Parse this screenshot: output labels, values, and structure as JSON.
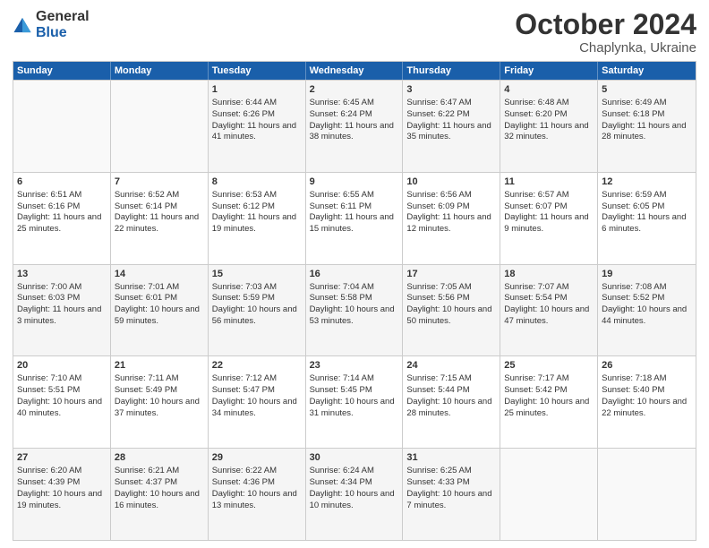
{
  "logo": {
    "general": "General",
    "blue": "Blue"
  },
  "header": {
    "month": "October 2024",
    "location": "Chaplynka, Ukraine"
  },
  "days_of_week": [
    "Sunday",
    "Monday",
    "Tuesday",
    "Wednesday",
    "Thursday",
    "Friday",
    "Saturday"
  ],
  "rows": [
    [
      {
        "day": "",
        "sunrise": "",
        "sunset": "",
        "daylight": ""
      },
      {
        "day": "",
        "sunrise": "",
        "sunset": "",
        "daylight": ""
      },
      {
        "day": "1",
        "sunrise": "Sunrise: 6:44 AM",
        "sunset": "Sunset: 6:26 PM",
        "daylight": "Daylight: 11 hours and 41 minutes."
      },
      {
        "day": "2",
        "sunrise": "Sunrise: 6:45 AM",
        "sunset": "Sunset: 6:24 PM",
        "daylight": "Daylight: 11 hours and 38 minutes."
      },
      {
        "day": "3",
        "sunrise": "Sunrise: 6:47 AM",
        "sunset": "Sunset: 6:22 PM",
        "daylight": "Daylight: 11 hours and 35 minutes."
      },
      {
        "day": "4",
        "sunrise": "Sunrise: 6:48 AM",
        "sunset": "Sunset: 6:20 PM",
        "daylight": "Daylight: 11 hours and 32 minutes."
      },
      {
        "day": "5",
        "sunrise": "Sunrise: 6:49 AM",
        "sunset": "Sunset: 6:18 PM",
        "daylight": "Daylight: 11 hours and 28 minutes."
      }
    ],
    [
      {
        "day": "6",
        "sunrise": "Sunrise: 6:51 AM",
        "sunset": "Sunset: 6:16 PM",
        "daylight": "Daylight: 11 hours and 25 minutes."
      },
      {
        "day": "7",
        "sunrise": "Sunrise: 6:52 AM",
        "sunset": "Sunset: 6:14 PM",
        "daylight": "Daylight: 11 hours and 22 minutes."
      },
      {
        "day": "8",
        "sunrise": "Sunrise: 6:53 AM",
        "sunset": "Sunset: 6:12 PM",
        "daylight": "Daylight: 11 hours and 19 minutes."
      },
      {
        "day": "9",
        "sunrise": "Sunrise: 6:55 AM",
        "sunset": "Sunset: 6:11 PM",
        "daylight": "Daylight: 11 hours and 15 minutes."
      },
      {
        "day": "10",
        "sunrise": "Sunrise: 6:56 AM",
        "sunset": "Sunset: 6:09 PM",
        "daylight": "Daylight: 11 hours and 12 minutes."
      },
      {
        "day": "11",
        "sunrise": "Sunrise: 6:57 AM",
        "sunset": "Sunset: 6:07 PM",
        "daylight": "Daylight: 11 hours and 9 minutes."
      },
      {
        "day": "12",
        "sunrise": "Sunrise: 6:59 AM",
        "sunset": "Sunset: 6:05 PM",
        "daylight": "Daylight: 11 hours and 6 minutes."
      }
    ],
    [
      {
        "day": "13",
        "sunrise": "Sunrise: 7:00 AM",
        "sunset": "Sunset: 6:03 PM",
        "daylight": "Daylight: 11 hours and 3 minutes."
      },
      {
        "day": "14",
        "sunrise": "Sunrise: 7:01 AM",
        "sunset": "Sunset: 6:01 PM",
        "daylight": "Daylight: 10 hours and 59 minutes."
      },
      {
        "day": "15",
        "sunrise": "Sunrise: 7:03 AM",
        "sunset": "Sunset: 5:59 PM",
        "daylight": "Daylight: 10 hours and 56 minutes."
      },
      {
        "day": "16",
        "sunrise": "Sunrise: 7:04 AM",
        "sunset": "Sunset: 5:58 PM",
        "daylight": "Daylight: 10 hours and 53 minutes."
      },
      {
        "day": "17",
        "sunrise": "Sunrise: 7:05 AM",
        "sunset": "Sunset: 5:56 PM",
        "daylight": "Daylight: 10 hours and 50 minutes."
      },
      {
        "day": "18",
        "sunrise": "Sunrise: 7:07 AM",
        "sunset": "Sunset: 5:54 PM",
        "daylight": "Daylight: 10 hours and 47 minutes."
      },
      {
        "day": "19",
        "sunrise": "Sunrise: 7:08 AM",
        "sunset": "Sunset: 5:52 PM",
        "daylight": "Daylight: 10 hours and 44 minutes."
      }
    ],
    [
      {
        "day": "20",
        "sunrise": "Sunrise: 7:10 AM",
        "sunset": "Sunset: 5:51 PM",
        "daylight": "Daylight: 10 hours and 40 minutes."
      },
      {
        "day": "21",
        "sunrise": "Sunrise: 7:11 AM",
        "sunset": "Sunset: 5:49 PM",
        "daylight": "Daylight: 10 hours and 37 minutes."
      },
      {
        "day": "22",
        "sunrise": "Sunrise: 7:12 AM",
        "sunset": "Sunset: 5:47 PM",
        "daylight": "Daylight: 10 hours and 34 minutes."
      },
      {
        "day": "23",
        "sunrise": "Sunrise: 7:14 AM",
        "sunset": "Sunset: 5:45 PM",
        "daylight": "Daylight: 10 hours and 31 minutes."
      },
      {
        "day": "24",
        "sunrise": "Sunrise: 7:15 AM",
        "sunset": "Sunset: 5:44 PM",
        "daylight": "Daylight: 10 hours and 28 minutes."
      },
      {
        "day": "25",
        "sunrise": "Sunrise: 7:17 AM",
        "sunset": "Sunset: 5:42 PM",
        "daylight": "Daylight: 10 hours and 25 minutes."
      },
      {
        "day": "26",
        "sunrise": "Sunrise: 7:18 AM",
        "sunset": "Sunset: 5:40 PM",
        "daylight": "Daylight: 10 hours and 22 minutes."
      }
    ],
    [
      {
        "day": "27",
        "sunrise": "Sunrise: 6:20 AM",
        "sunset": "Sunset: 4:39 PM",
        "daylight": "Daylight: 10 hours and 19 minutes."
      },
      {
        "day": "28",
        "sunrise": "Sunrise: 6:21 AM",
        "sunset": "Sunset: 4:37 PM",
        "daylight": "Daylight: 10 hours and 16 minutes."
      },
      {
        "day": "29",
        "sunrise": "Sunrise: 6:22 AM",
        "sunset": "Sunset: 4:36 PM",
        "daylight": "Daylight: 10 hours and 13 minutes."
      },
      {
        "day": "30",
        "sunrise": "Sunrise: 6:24 AM",
        "sunset": "Sunset: 4:34 PM",
        "daylight": "Daylight: 10 hours and 10 minutes."
      },
      {
        "day": "31",
        "sunrise": "Sunrise: 6:25 AM",
        "sunset": "Sunset: 4:33 PM",
        "daylight": "Daylight: 10 hours and 7 minutes."
      },
      {
        "day": "",
        "sunrise": "",
        "sunset": "",
        "daylight": ""
      },
      {
        "day": "",
        "sunrise": "",
        "sunset": "",
        "daylight": ""
      }
    ]
  ]
}
